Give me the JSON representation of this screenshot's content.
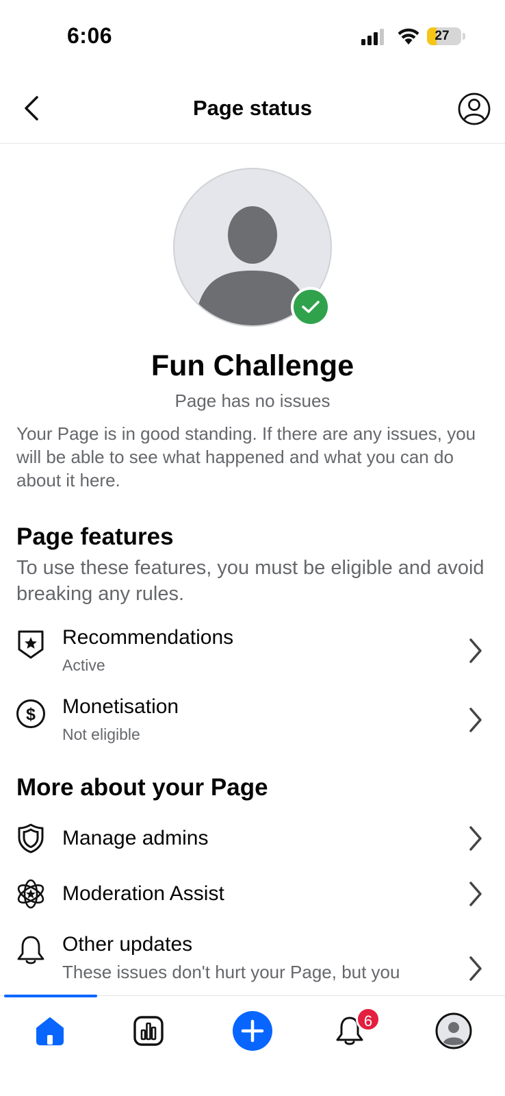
{
  "status_bar": {
    "time": "6:06",
    "battery_level": "27",
    "battery_fraction": 0.27
  },
  "header": {
    "title": "Page status",
    "back_icon": "chevron-left-icon",
    "profile_icon": "person-circle-icon"
  },
  "page": {
    "name": "Fun Challenge",
    "status": "Page has no issues",
    "description": "Your Page is in good standing. If there are any issues, you will be able to see what happened and what you can do about it here.",
    "verified_icon": "check-icon"
  },
  "features": {
    "title": "Page features",
    "subtitle": "To use these features, you must be eligible and avoid breaking any rules.",
    "items": [
      {
        "label": "Recommendations",
        "status": "Active",
        "icon": "shield-star-icon"
      },
      {
        "label": "Monetisation",
        "status": "Not eligible",
        "icon": "dollar-circle-icon"
      }
    ]
  },
  "more": {
    "title": "More about your Page",
    "items": [
      {
        "label": "Manage admins",
        "icon": "shield-icon"
      },
      {
        "label": "Moderation Assist",
        "icon": "atom-star-icon"
      },
      {
        "label": "Other updates",
        "sub": "These issues don't hurt your Page, but you",
        "icon": "bell-icon"
      }
    ]
  },
  "tab_bar": {
    "tabs": [
      "home-icon",
      "insights-icon",
      "create-icon",
      "notifications-icon",
      "profile-icon"
    ],
    "notification_count": "6"
  },
  "colors": {
    "accent": "#0866ff",
    "success": "#31a24c",
    "badge": "#e41e3f",
    "secondary_text": "#65676b",
    "battery": "#f5c518"
  }
}
